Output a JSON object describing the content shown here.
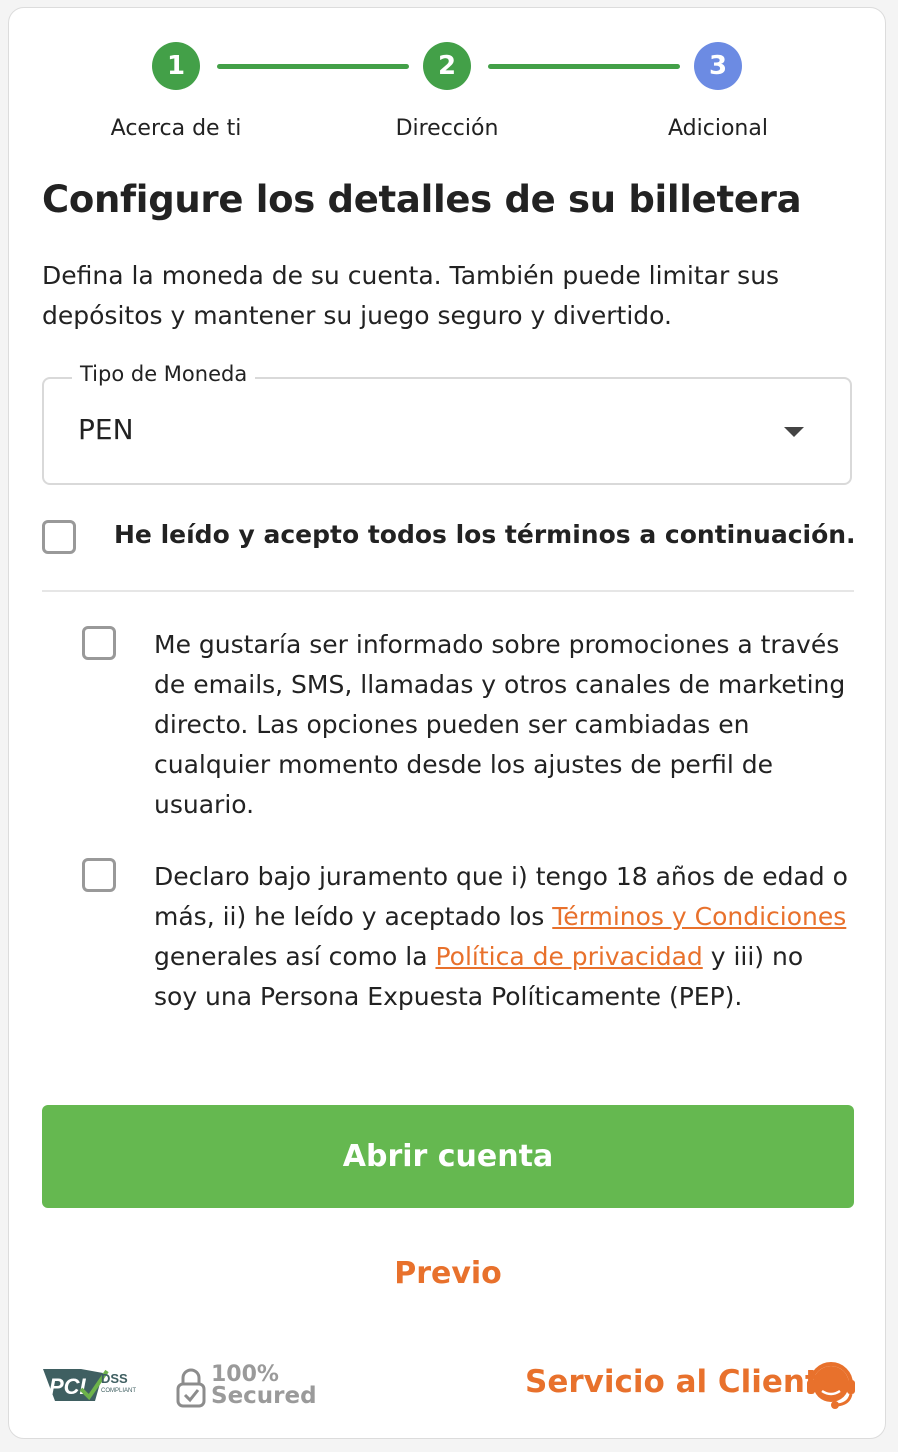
{
  "stepper": {
    "steps": [
      {
        "number": "1",
        "label": "Acerca de ti",
        "state": "done"
      },
      {
        "number": "2",
        "label": "Dirección",
        "state": "done"
      },
      {
        "number": "3",
        "label": "Adicional",
        "state": "active"
      }
    ],
    "colors": {
      "done": "#43a048",
      "active": "#6c8be3"
    }
  },
  "header": {
    "title": "Configure los detalles de su billetera",
    "subtitle": "Defina la moneda de su cuenta. También puede limitar sus depósitos y mantener su juego seguro y divertido."
  },
  "currency": {
    "label": "Tipo de Moneda",
    "value": "PEN"
  },
  "terms": {
    "accept_all": "He leído y acepto todos los términos a continuación.",
    "marketing": "Me gustaría ser informado sobre promociones a través de emails, SMS, llamadas y otros canales de marketing directo. Las opciones pueden ser cambiadas en cualquier momento desde los ajustes de perfil de usuario.",
    "declaration": {
      "part1": "Declaro bajo juramento que i) tengo 18 años de edad o más, ii) he leído y aceptado los ",
      "link_terms": "Términos y Condiciones",
      "part2": " generales así como la ",
      "link_privacy": "Política de privacidad",
      "part3": " y iii) no soy una Persona Expuesta Políticamente (PEP)."
    }
  },
  "actions": {
    "open_account": "Abrir cuenta",
    "previous": "Previo"
  },
  "footer": {
    "pci_logo_text": "PCI DSS COMPLIANT",
    "secured_text_1": "100%",
    "secured_text_2": "Secured",
    "customer_service": "Servicio al Cliente",
    "customer_service_icon": "headset-icon"
  },
  "colors": {
    "accent": "#e8712c",
    "primary_button": "#65b850"
  }
}
